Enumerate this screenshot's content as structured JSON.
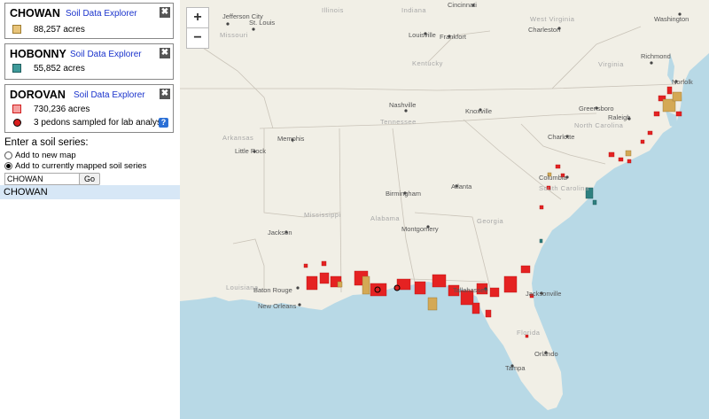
{
  "cards": [
    {
      "title": "CHOWAN",
      "link": "Soil Data Explorer",
      "swatch": "#e8c47a",
      "swatch_border": "#a07d30",
      "text": "88,257 acres"
    },
    {
      "title": "HOBONNY",
      "link": "Soil Data Explorer",
      "swatch": "#3e9a9a",
      "swatch_border": "#1f5f5f",
      "text": "55,852 acres"
    },
    {
      "title": "DOROVAN",
      "link": "Soil Data Explorer",
      "swatch": "#f5a0a0",
      "swatch_border": "#d21e1e",
      "text": "730,236 acres",
      "pedons": "3 pedons sampled for lab analysis",
      "help": "?"
    }
  ],
  "close_symbol": "✖",
  "search": {
    "label": "Enter a soil series:",
    "option_new": "Add to new map",
    "option_current": "Add to currently mapped soil series",
    "value": "CHOWAN",
    "go": "Go",
    "suggestion": "CHOWAN"
  },
  "zoom": {
    "in": "+",
    "out": "−"
  },
  "map": {
    "cities": {
      "st_louis": "St. Louis",
      "jefferson_city": "Jefferson City",
      "cincinnati": "Cincinnati",
      "washington": "Washington",
      "charleston_wv": "Charleston",
      "louisville": "Louisville",
      "frankfort": "Frankfort",
      "richmond": "Richmond",
      "norfolk": "Norfolk",
      "nashville": "Nashville",
      "knoxville": "Knoxville",
      "greensboro": "Greensboro",
      "raleigh": "Raleigh",
      "memphis": "Memphis",
      "little_rock": "Little Rock",
      "charlotte": "Charlotte",
      "columbia": "Columbia",
      "atlanta": "Atlanta",
      "birmingham": "Birmingham",
      "jackson": "Jackson",
      "montgomery": "Montgomery",
      "baton_rouge": "Baton Rouge",
      "new_orleans": "New Orleans",
      "tallahassee": "Tallahassee",
      "jacksonville": "Jacksonville",
      "orlando": "Orlando",
      "tampa": "Tampa"
    },
    "states": {
      "missouri": "Missouri",
      "illinois": "Illinois",
      "indiana": "Indiana",
      "west_virginia": "West Virginia",
      "virginia": "Virginia",
      "kentucky": "Kentucky",
      "tennessee": "Tennessee",
      "north_carolina": "North Carolina",
      "arkansas": "Arkansas",
      "south_carolina": "South Carolina",
      "georgia": "Georgia",
      "alabama": "Alabama",
      "mississippi": "Mississippi",
      "louisiana": "Louisiana",
      "florida": "Florida"
    }
  },
  "colors": {
    "land": "#f1efe6",
    "water": "#b8d9e6",
    "dorovan": "#e52222",
    "chowan": "#d4a955",
    "hobonny": "#2e8080"
  }
}
